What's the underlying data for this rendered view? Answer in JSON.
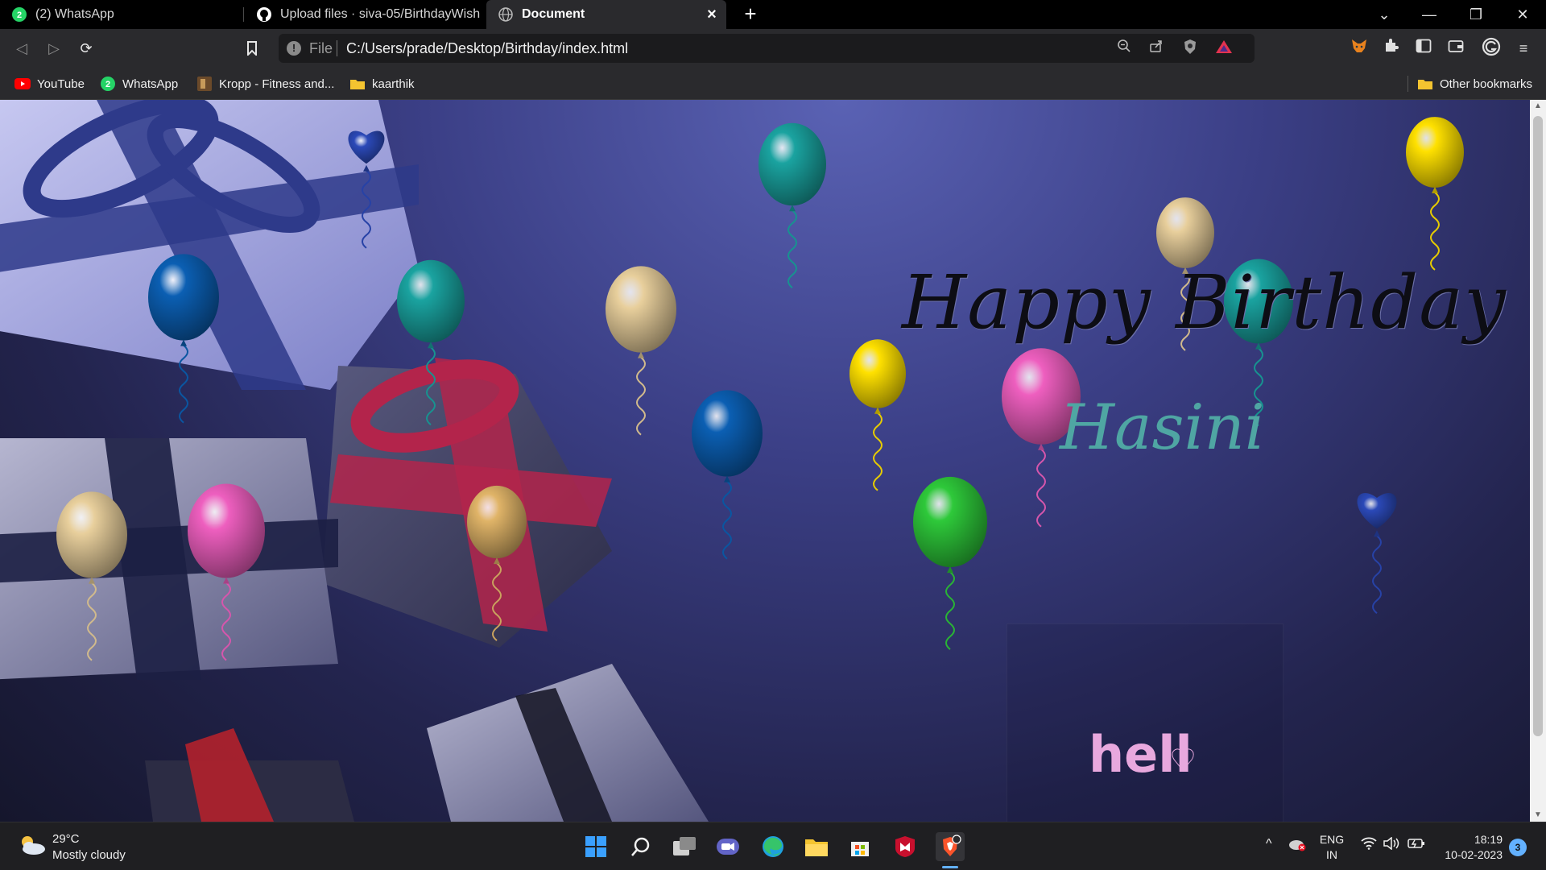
{
  "browser": {
    "tabs": [
      {
        "title": "(2) WhatsApp",
        "icon": "whatsapp-icon",
        "badge": "2"
      },
      {
        "title": "Upload files · siva-05/BirthdayWish",
        "icon": "github-icon"
      },
      {
        "title": "Document",
        "icon": "globe-icon",
        "active": true
      }
    ],
    "url_scheme": "File",
    "url": "C:/Users/prade/Desktop/Birthday/index.html",
    "bookmarks": [
      {
        "label": "YouTube",
        "icon": "youtube-icon"
      },
      {
        "label": "WhatsApp",
        "icon": "whatsapp-icon"
      },
      {
        "label": "Kropp - Fitness and...",
        "icon": "kropp-icon"
      },
      {
        "label": "kaarthik",
        "icon": "folder-icon"
      }
    ],
    "other_bookmarks": "Other bookmarks"
  },
  "page": {
    "title": "Happy Birthday",
    "name": "Hasini",
    "hello": "hell"
  },
  "balloons": [
    {
      "color": "#2b49b8",
      "shape": "heart"
    },
    {
      "color": "#1aa3a0",
      "shape": "round"
    },
    {
      "color": "#ffe100",
      "shape": "round"
    },
    {
      "color": "#0b5fb3",
      "shape": "round"
    },
    {
      "color": "#1aa3a0",
      "shape": "round"
    },
    {
      "color": "#e8cf9c",
      "shape": "round"
    },
    {
      "color": "#ffe100",
      "shape": "round"
    },
    {
      "color": "#ee5fbf",
      "shape": "round"
    },
    {
      "color": "#e8cf9c",
      "shape": "round"
    },
    {
      "color": "#1aa3a0",
      "shape": "round"
    },
    {
      "color": "#0b5fb3",
      "shape": "round"
    },
    {
      "color": "#2ec93a",
      "shape": "round"
    },
    {
      "color": "#e8cf9c",
      "shape": "round"
    },
    {
      "color": "#ee5fbf",
      "shape": "round"
    },
    {
      "color": "#e0b468",
      "shape": "round"
    },
    {
      "color": "#2b49b8",
      "shape": "heart"
    }
  ],
  "taskbar": {
    "weather_temp": "29°C",
    "weather_desc": "Mostly cloudy",
    "lang_top": "ENG",
    "lang_bottom": "IN",
    "time": "18:19",
    "date": "10-02-2023",
    "notifications": "3"
  }
}
